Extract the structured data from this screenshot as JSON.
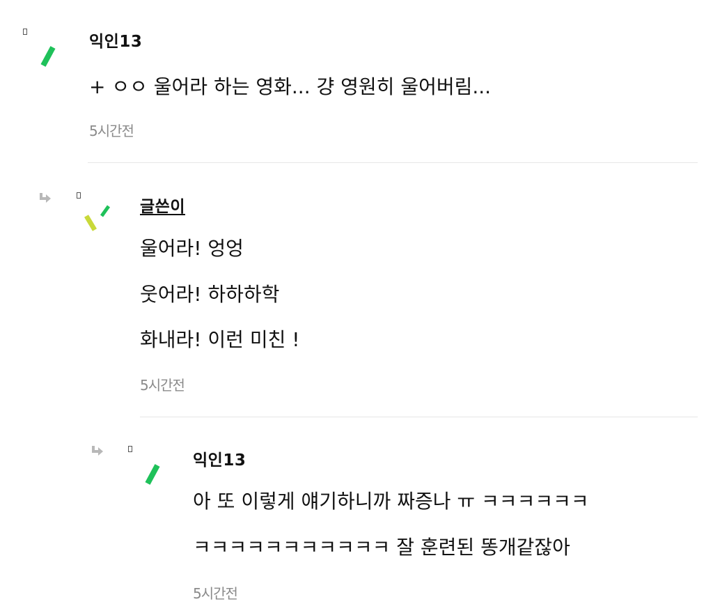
{
  "comments": [
    {
      "author": "익인13",
      "lines": [
        "+ ㅇㅇ 울어라 하는 영화... 걍 영원히 울어버림..."
      ],
      "time": "5시간전"
    },
    {
      "author": "글쓴이",
      "lines": [
        "울어라! 엉엉",
        "웃어라! 하하하학",
        "화내라! 이런 미친 !"
      ],
      "time": "5시간전"
    },
    {
      "author": "익인13",
      "lines": [
        "아 또 이렇게 얘기하니까 짜증나 ㅠ ㅋㅋㅋㅋㅋㅋ",
        "ㅋㅋㅋㅋㅋㅋㅋㅋㅋㅋㅋ 잘 훈련된 똥개같잖아"
      ],
      "time": "5시간전"
    }
  ],
  "icons": {
    "reply": "reply-arrow-icon",
    "menu": "small-square-icon",
    "avatar_anon": "green-slash-avatar-icon",
    "avatar_writer": "green-yellow-slash-avatar-icon"
  },
  "colors": {
    "avatar_green": "#1fc15a",
    "avatar_yellow": "#c9d93a",
    "time_gray": "#8a8a8a",
    "divider": "#e6e6e6",
    "reply_arrow_gray": "#b8b8b8"
  }
}
